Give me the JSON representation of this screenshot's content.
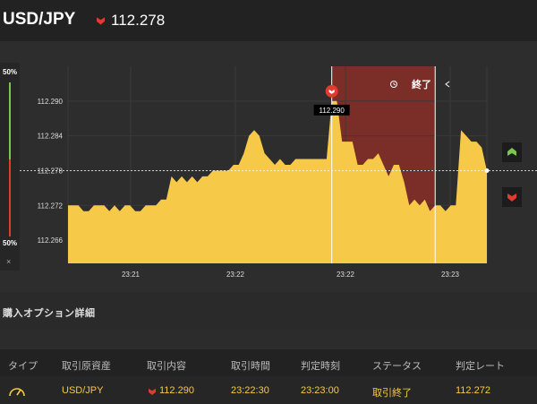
{
  "header": {
    "pair": "USD/JPY",
    "current_rate": "112.278",
    "direction": "down",
    "down_color": "#e23a2e",
    "up_color": "#7ac74f"
  },
  "side_panel": {
    "top_pct": "50%",
    "bottom_pct": "50%",
    "close_symbol": "×",
    "up_button_icon": "arrow-up-icon",
    "down_button_icon": "arrow-down-icon"
  },
  "chart_data": {
    "type": "area",
    "ylim": [
      112.262,
      112.296
    ],
    "y_ticks": [
      "112.290",
      "112.284",
      "112.278",
      "112.272",
      "112.266"
    ],
    "y_tick_values": [
      112.29,
      112.284,
      112.278,
      112.272,
      112.266
    ],
    "x_ticks": [
      "23:21",
      "23:22",
      "23:22",
      "23:23"
    ],
    "current_line": 112.278,
    "entry_label": "112.290",
    "entry_value": 112.29,
    "end_label": "終了",
    "fill_color": "#f7c948",
    "expiry_zone_color": "#7a2e27",
    "values": [
      112.272,
      112.272,
      112.272,
      112.271,
      112.271,
      112.272,
      112.272,
      112.272,
      112.271,
      112.272,
      112.271,
      112.272,
      112.272,
      112.271,
      112.271,
      112.272,
      112.272,
      112.272,
      112.273,
      112.273,
      112.277,
      112.276,
      112.277,
      112.276,
      112.277,
      112.276,
      112.277,
      112.277,
      112.278,
      112.278,
      112.278,
      112.278,
      112.279,
      112.279,
      112.281,
      112.284,
      112.285,
      112.284,
      112.281,
      112.28,
      112.279,
      112.28,
      112.279,
      112.279,
      112.28,
      112.28,
      112.28,
      112.28,
      112.28,
      112.28,
      112.28,
      112.29,
      112.29,
      112.283,
      112.283,
      112.283,
      112.279,
      112.279,
      112.28,
      112.28,
      112.281,
      112.279,
      112.277,
      112.279,
      112.279,
      112.276,
      112.272,
      112.273,
      112.272,
      112.273,
      112.271,
      112.272,
      112.272,
      112.271,
      112.272,
      112.272,
      112.285,
      112.284,
      112.283,
      112.283,
      112.282,
      112.278
    ]
  },
  "section": {
    "title": "購入オプション詳細"
  },
  "table": {
    "headers": [
      "タイプ",
      "取引原資産",
      "取引内容",
      "取引時間",
      "判定時刻",
      "ステータス",
      "判定レート"
    ],
    "row": {
      "type_icon": "gauge-icon",
      "asset": "USD/JPY",
      "trade": "112.290",
      "trade_direction": "down",
      "trade_time": "23:22:30",
      "judge_time": "23:23:00",
      "status": "取引終了",
      "judge_rate": "112.272"
    }
  }
}
